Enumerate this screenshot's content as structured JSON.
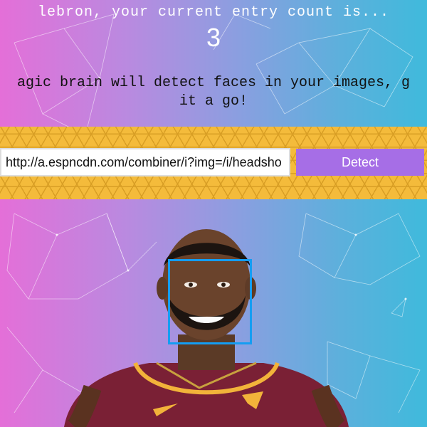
{
  "header": {
    "entry_text": "lebron, your current entry count is...",
    "entry_count": "3"
  },
  "description": {
    "line1": "agic brain will detect faces in your images, g",
    "line2": "it a go!"
  },
  "form": {
    "url_value": "http://a.espncdn.com/combiner/i?img=/i/headsho",
    "detect_label": "Detect"
  },
  "colors": {
    "gradient_left": "#e46fd8",
    "gradient_right": "#3fbadc",
    "honeycomb": "#f4bb3b",
    "button": "#a66ee6",
    "face_box": "#149df2"
  },
  "image": {
    "subject": "face-photo"
  }
}
